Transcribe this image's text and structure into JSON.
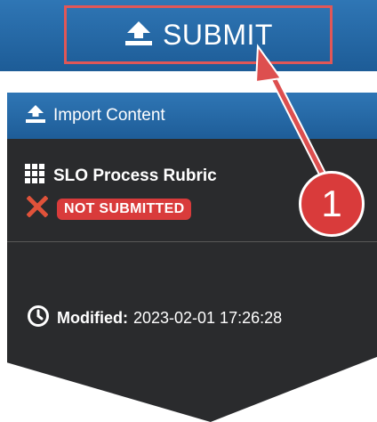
{
  "submit": {
    "label": "SUBMIT"
  },
  "import_header": {
    "label": "Import Content"
  },
  "item": {
    "title": "SLO Process Rubric",
    "status": "NOT SUBMITTED"
  },
  "modified": {
    "label": "Modified:",
    "value": "2023-02-01 17:26:28"
  },
  "annotation": {
    "step": "1"
  },
  "colors": {
    "primary_blue": "#2f76b5",
    "panel_dark": "#2a2b2d",
    "alert_red": "#d93b3b",
    "highlight_border": "#e15757"
  },
  "icons": {
    "submit": "upload-icon",
    "import": "upload-icon",
    "rubric": "grid-icon",
    "status": "x-mark-icon",
    "modified": "clock-icon"
  }
}
